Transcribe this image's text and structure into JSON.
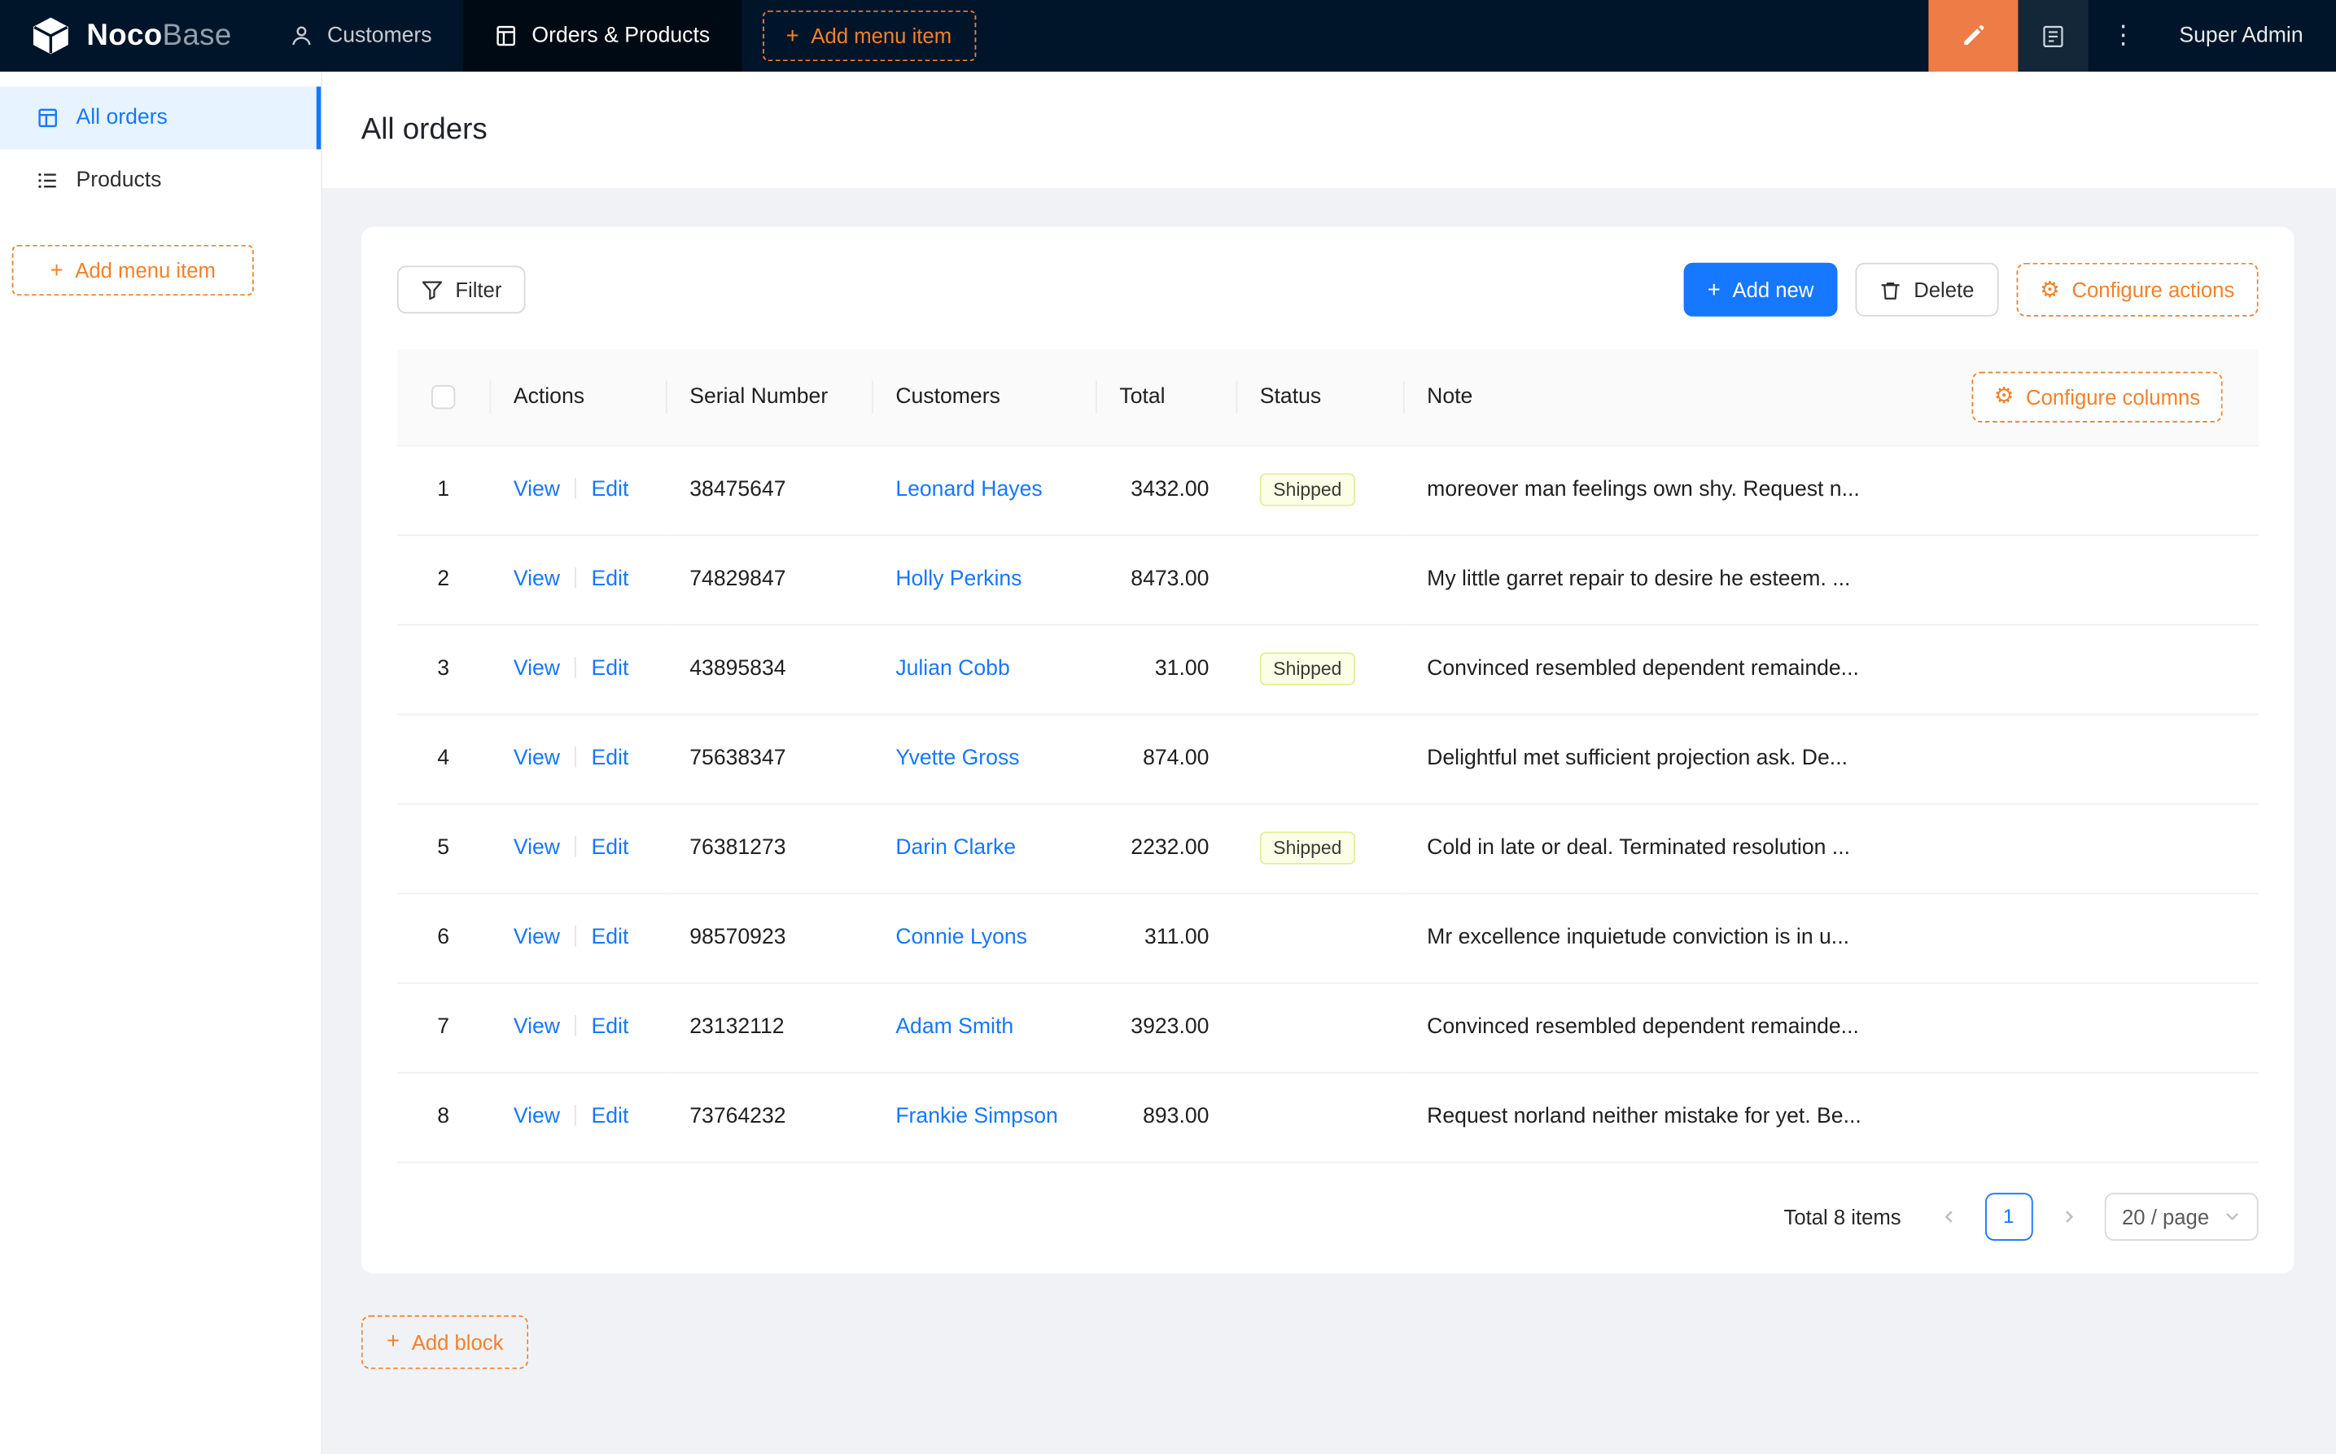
{
  "header": {
    "brand_bold": "Noco",
    "brand_light": "Base",
    "menu": [
      {
        "label": "Customers"
      },
      {
        "label": "Orders & Products"
      }
    ],
    "add_menu_item_label": "Add menu item",
    "user": "Super Admin"
  },
  "sidebar": {
    "items": [
      {
        "label": "All orders"
      },
      {
        "label": "Products"
      }
    ],
    "add_menu_item_label": "Add menu item"
  },
  "page": {
    "title": "All orders"
  },
  "toolbar": {
    "filter_label": "Filter",
    "add_new_label": "Add new",
    "delete_label": "Delete",
    "configure_actions_label": "Configure actions"
  },
  "table": {
    "columns": {
      "actions": "Actions",
      "serial": "Serial Number",
      "customers": "Customers",
      "total": "Total",
      "status": "Status",
      "note": "Note"
    },
    "configure_columns_label": "Configure columns",
    "action_view": "View",
    "action_edit": "Edit",
    "rows": [
      {
        "index": "1",
        "serial": "38475647",
        "customer": "Leonard Hayes",
        "total": "3432.00",
        "status": "Shipped",
        "note": "moreover man feelings own shy. Request n..."
      },
      {
        "index": "2",
        "serial": "74829847",
        "customer": "Holly Perkins",
        "total": "8473.00",
        "status": "",
        "note": "My little garret repair to desire he esteem. ..."
      },
      {
        "index": "3",
        "serial": "43895834",
        "customer": "Julian Cobb",
        "total": "31.00",
        "status": "Shipped",
        "note": "Convinced resembled dependent remainde..."
      },
      {
        "index": "4",
        "serial": "75638347",
        "customer": "Yvette Gross",
        "total": "874.00",
        "status": "",
        "note": "Delightful met sufficient projection ask. De..."
      },
      {
        "index": "5",
        "serial": "76381273",
        "customer": "Darin Clarke",
        "total": "2232.00",
        "status": "Shipped",
        "note": "Cold in late or deal. Terminated resolution ..."
      },
      {
        "index": "6",
        "serial": "98570923",
        "customer": "Connie Lyons",
        "total": "311.00",
        "status": "",
        "note": "Mr excellence inquietude conviction is in u..."
      },
      {
        "index": "7",
        "serial": "23132112",
        "customer": "Adam Smith",
        "total": "3923.00",
        "status": "",
        "note": "Convinced resembled dependent remainde..."
      },
      {
        "index": "8",
        "serial": "73764232",
        "customer": "Frankie Simpson",
        "total": "893.00",
        "status": "",
        "note": "Request norland neither mistake for yet. Be..."
      }
    ]
  },
  "pagination": {
    "total_label": "Total 8 items",
    "current_page": "1",
    "page_size_label": "20 / page"
  },
  "footer": {
    "add_block_label": "Add block"
  },
  "icons": {
    "plus": "+",
    "ellipsis": "⋮",
    "gear": "⚙"
  },
  "colors": {
    "header_bg": "#001529",
    "accent_orange": "#f2812b",
    "primary_blue": "#1677ff",
    "selected_menu_bg": "#e7f4ff",
    "tag_shipped_bg": "#fcffe6",
    "tag_shipped_border": "#e3ee97"
  }
}
